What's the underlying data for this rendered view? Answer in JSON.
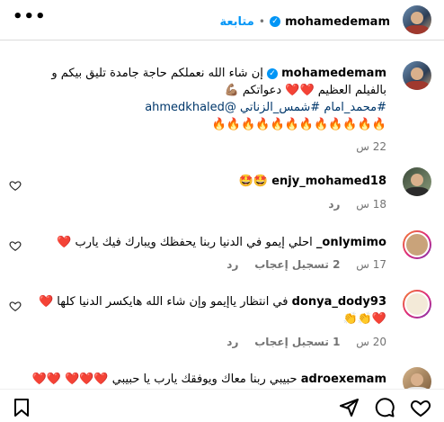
{
  "header": {
    "username": "mohamedemam",
    "follow_label": "متابعة",
    "dot_sep": "•",
    "more": "•••"
  },
  "post": {
    "username": "mohamedemam",
    "caption_line1": "إن شاء الله نعملكم حاجة جامدة تليق بيكم و",
    "caption_line2": "بالفيلم العظيم ❤️❤️ دعواتكم 💪🏽",
    "tags": "#محمد_امام #شمس_الزناتي @ahmedkhaled",
    "fire": "🔥🔥🔥🔥🔥🔥🔥🔥🔥🔥🔥🔥",
    "time": "22 س"
  },
  "comments": [
    {
      "username": "enjy_mohamed18",
      "text": "🤩🤩",
      "time": "18 س",
      "likes": "",
      "reply": "رد"
    },
    {
      "username": "onlymimo_",
      "text": "احلي إيمو في الدنيا ربنا يحفظك ويبارك فيك يارب ❤️",
      "time": "17 س",
      "likes": "2 تسجيل إعجاب",
      "reply": "رد"
    },
    {
      "username": "donya_dody93",
      "text": "في انتظار ياإيمو وإن شاء الله هايكسر الدنيا كلها ❤️",
      "text2": "❤️👏👏",
      "time": "20 س",
      "likes": "1 تسجيل إعجاب",
      "reply": "رد"
    },
    {
      "username": "adroexemam",
      "text": "حبيبي ربنا معاك ويوفقك يارب يا حبيبي ❤️❤️❤️ ❤️❤️"
    }
  ],
  "icons": [
    "bookmark-icon",
    "share-icon",
    "comment-icon",
    "heart-icon"
  ]
}
